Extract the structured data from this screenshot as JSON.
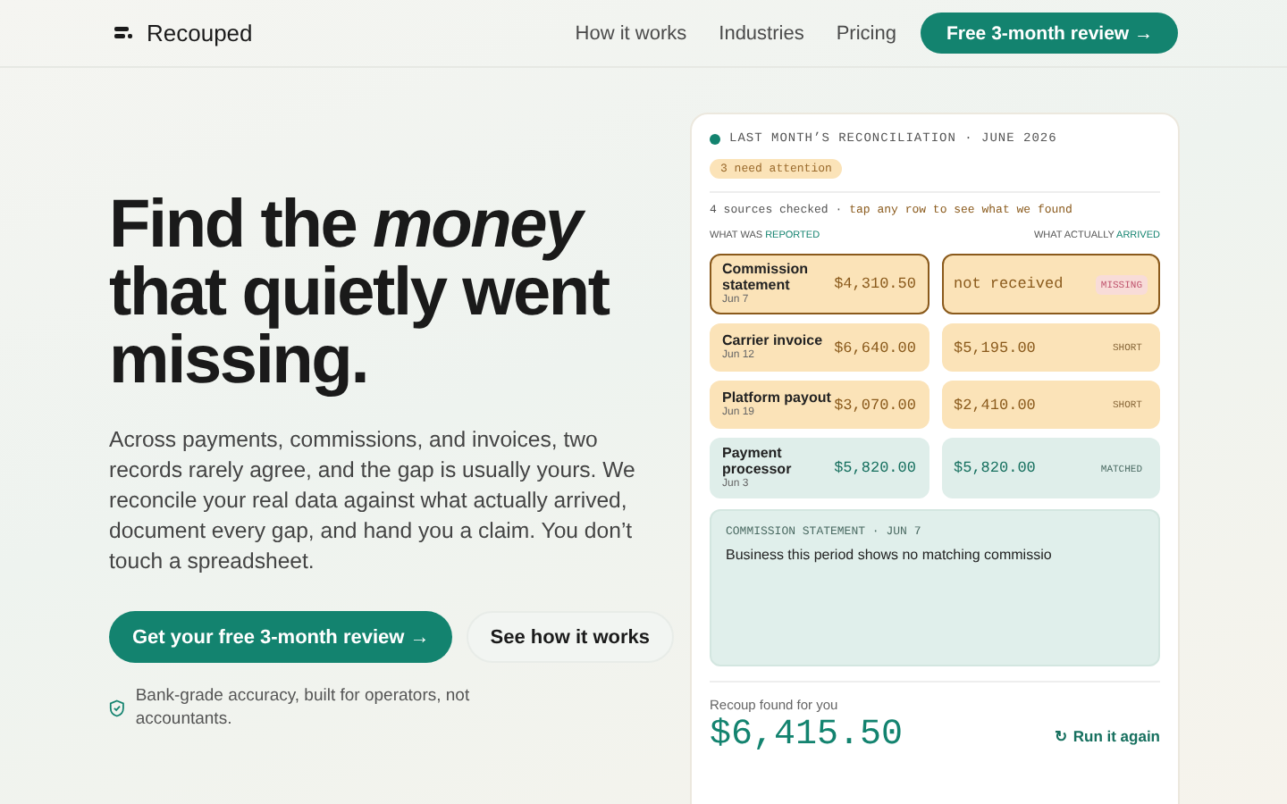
{
  "nav": {
    "brand": "Recouped",
    "links": [
      "How it works",
      "Industries",
      "Pricing"
    ],
    "cta": "Free 3-month review →"
  },
  "hero": {
    "headline": "Find the *money* that quietly went missing.",
    "body": "Across payments, commissions, and invoices, two records rarely agree, and the gap is usually yours. We reconcile your real data against what actually arrived, document every gap, and hand you a claim. You don’t touch a spreadsheet.",
    "primary": "Get your free 3-month review →",
    "secondary": "See how it works",
    "note": "Bank-grade accuracy, built for operators, not accountants."
  },
  "card": {
    "title": "LAST MONTH’S RECONCILIATION · JUNE 2026",
    "badge": "3 need attention",
    "summary": "4 sources checked ·",
    "hint": "tap any row to see what we found",
    "left_header": {
      "text": "WHAT WAS",
      "accent": "REPORTED"
    },
    "right_header": {
      "text": "WHAT ACTUALLY",
      "accent": "ARRIVED"
    },
    "rows": [
      {
        "name": "Commission statement",
        "date": "Jun 7",
        "reported": "$4,310.50",
        "arrived": "not received",
        "status": "MISSING",
        "kind": "missing",
        "selected": true
      },
      {
        "name": "Carrier invoice",
        "date": "Jun 12",
        "reported": "$6,640.00",
        "arrived": "$5,195.00",
        "status": "SHORT",
        "kind": "short",
        "selected": false
      },
      {
        "name": "Platform payout",
        "date": "Jun 19",
        "reported": "$3,070.00",
        "arrived": "$2,410.00",
        "status": "SHORT",
        "kind": "short",
        "selected": false
      },
      {
        "name": "Payment processor",
        "date": "Jun 3",
        "reported": "$5,820.00",
        "arrived": "$5,820.00",
        "status": "MATCHED",
        "kind": "matched",
        "selected": false
      }
    ],
    "detail": {
      "title": "COMMISSION STATEMENT · JUN 7",
      "text": "Business this period shows no matching commissio"
    },
    "total_label": "Recoup found for you",
    "total": "$6,415.50",
    "rerun": "↻ Run it again"
  }
}
